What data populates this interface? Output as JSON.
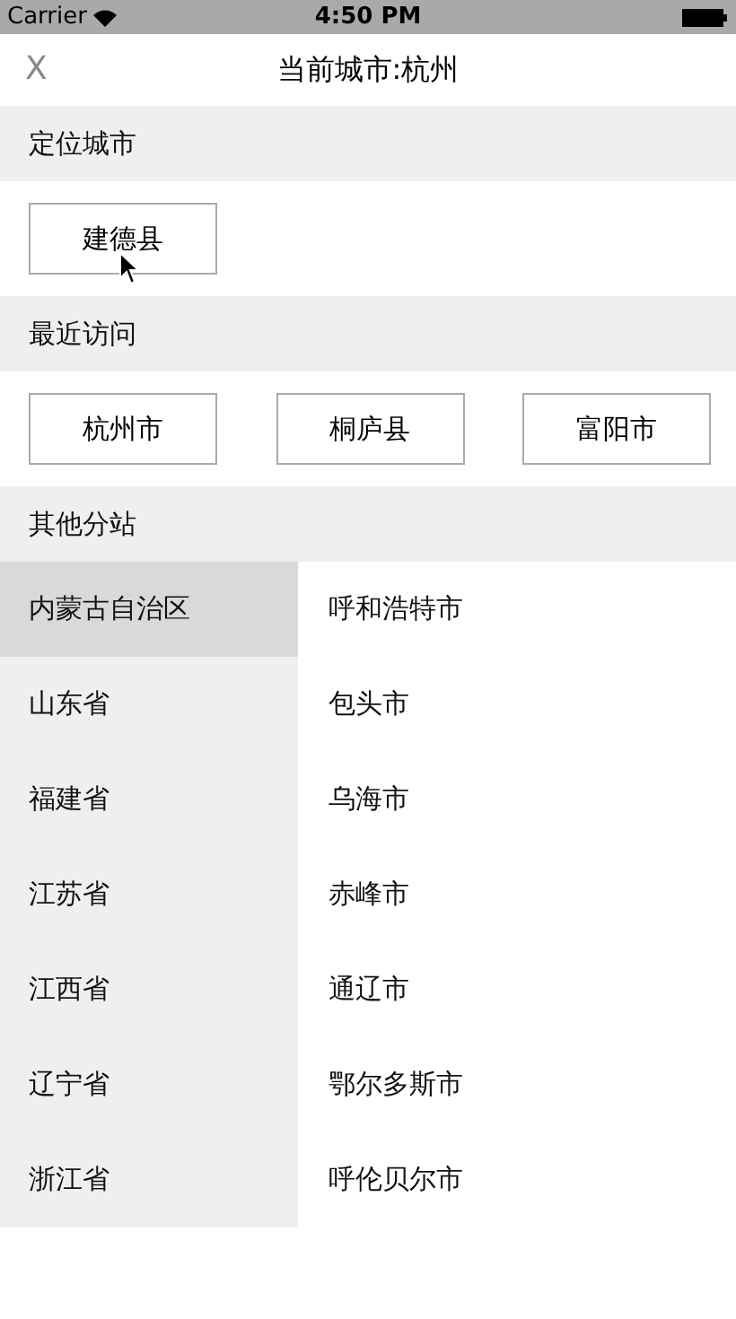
{
  "status_bar": {
    "carrier": "Carrier",
    "time": "4:50 PM"
  },
  "nav": {
    "close": "X",
    "title": "当前城市:杭州"
  },
  "location": {
    "header": "定位城市",
    "city": "建德县"
  },
  "recent": {
    "header": "最近访问",
    "cities": [
      "杭州市",
      "桐庐县",
      "富阳市"
    ]
  },
  "branches": {
    "header": "其他分站",
    "provinces": [
      {
        "name": "内蒙古自治区",
        "selected": true
      },
      {
        "name": "山东省",
        "selected": false
      },
      {
        "name": "福建省",
        "selected": false
      },
      {
        "name": "江苏省",
        "selected": false
      },
      {
        "name": "江西省",
        "selected": false
      },
      {
        "name": "辽宁省",
        "selected": false
      },
      {
        "name": "浙江省",
        "selected": false
      }
    ],
    "cities": [
      "呼和浩特市",
      "包头市",
      "乌海市",
      "赤峰市",
      "通辽市",
      "鄂尔多斯市",
      "呼伦贝尔市"
    ]
  }
}
